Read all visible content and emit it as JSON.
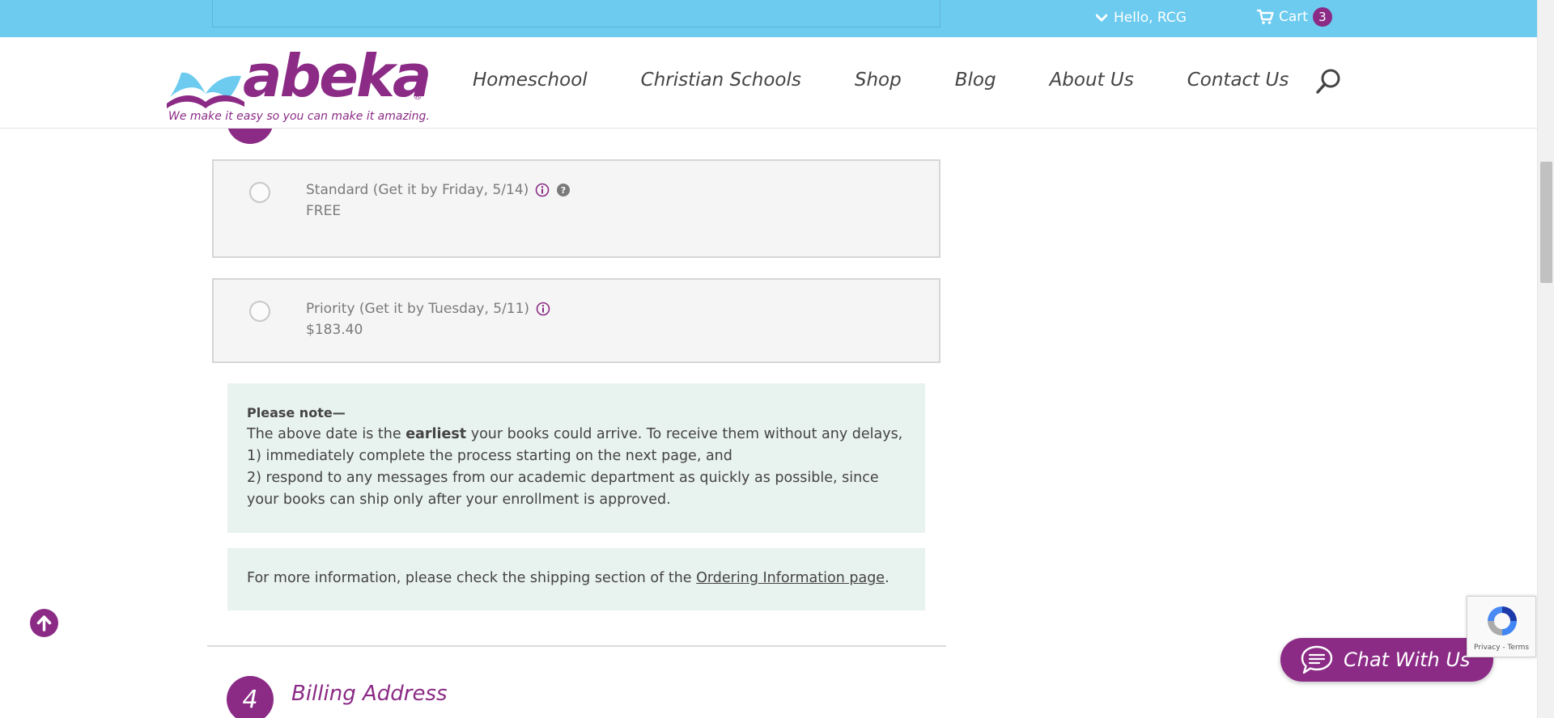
{
  "topbar": {
    "greeting": "Hello, RCG",
    "cart_label": "Cart",
    "cart_count": "3"
  },
  "logo": {
    "wordmark": "abeka",
    "registered": "®",
    "tagline": "We make it easy so you can make it amazing."
  },
  "nav": {
    "items": [
      "Homeschool",
      "Christian Schools",
      "Shop",
      "Blog",
      "About Us",
      "Contact Us"
    ]
  },
  "shipping": {
    "options": [
      {
        "label": "Standard (Get it by Friday, 5/14)",
        "price": "FREE",
        "icons": [
          "info-icon",
          "help-icon"
        ]
      },
      {
        "label": "Priority (Get it by Tuesday, 5/11)",
        "price": "$183.40",
        "icons": [
          "info-icon"
        ]
      }
    ],
    "note": {
      "title": "Please note—",
      "line1_pre": "The above date is the ",
      "line1_bold": "earliest",
      "line1_post": " your books could arrive. To receive them without any delays,",
      "line2": "1) immediately complete the process starting on the next page, and",
      "line3": "2) respond to any messages from our academic department as quickly as possible, since your books can ship only after your enrollment is approved."
    },
    "info": {
      "text": "For more information, please check the shipping section of the ",
      "link": "Ordering Information page",
      "suffix": "."
    }
  },
  "billing": {
    "step_number": "4",
    "title": "Billing Address"
  },
  "widgets": {
    "chat_label": "Chat With Us",
    "recaptcha_terms": "Privacy - Terms"
  },
  "colors": {
    "brand_purple": "#8b2b86",
    "topbar_blue": "#6ccbef",
    "note_bg": "#e8f2ee"
  }
}
